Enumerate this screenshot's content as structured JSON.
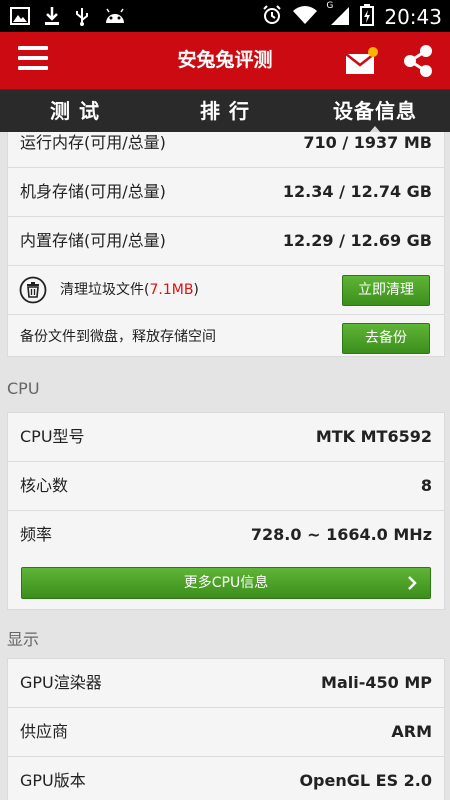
{
  "status_bar": {
    "time": "20:43",
    "network": "G"
  },
  "app_bar": {
    "title": "安兔兔评测"
  },
  "tabs": [
    {
      "label": "测 试",
      "active": false
    },
    {
      "label": "排 行",
      "active": false
    },
    {
      "label": "设备信息",
      "active": true
    }
  ],
  "storage": {
    "ram_label": "运行内存(可用/总量)",
    "ram_value": "710 / 1937 MB",
    "internal_label": "机身存储(可用/总量)",
    "internal_value": "12.34 / 12.74 GB",
    "builtin_label": "内置存储(可用/总量)",
    "builtin_value": "12.29 / 12.69 GB",
    "junk_label_prefix": "清理垃圾文件(",
    "junk_size": "7.1MB",
    "junk_label_suffix": ")",
    "clean_button": "立即清理",
    "backup_label": "备份文件到微盘，释放存储空间",
    "backup_button": "去备份"
  },
  "cpu": {
    "section_title": "CPU",
    "model_label": "CPU型号",
    "model_value": "MTK MT6592",
    "cores_label": "核心数",
    "cores_value": "8",
    "freq_label": "频率",
    "freq_value": "728.0 ~ 1664.0 MHz",
    "more_button": "更多CPU信息"
  },
  "display": {
    "section_title": "显示",
    "gpu_label": "GPU渲染器",
    "gpu_value": "Mali-450 MP",
    "vendor_label": "供应商",
    "vendor_value": "ARM",
    "version_label": "GPU版本",
    "version_value": "OpenGL ES 2.0"
  },
  "colors": {
    "app_bar": "#cc0a12",
    "button_green": "#4ea42a",
    "junk_size": "#e01010"
  }
}
